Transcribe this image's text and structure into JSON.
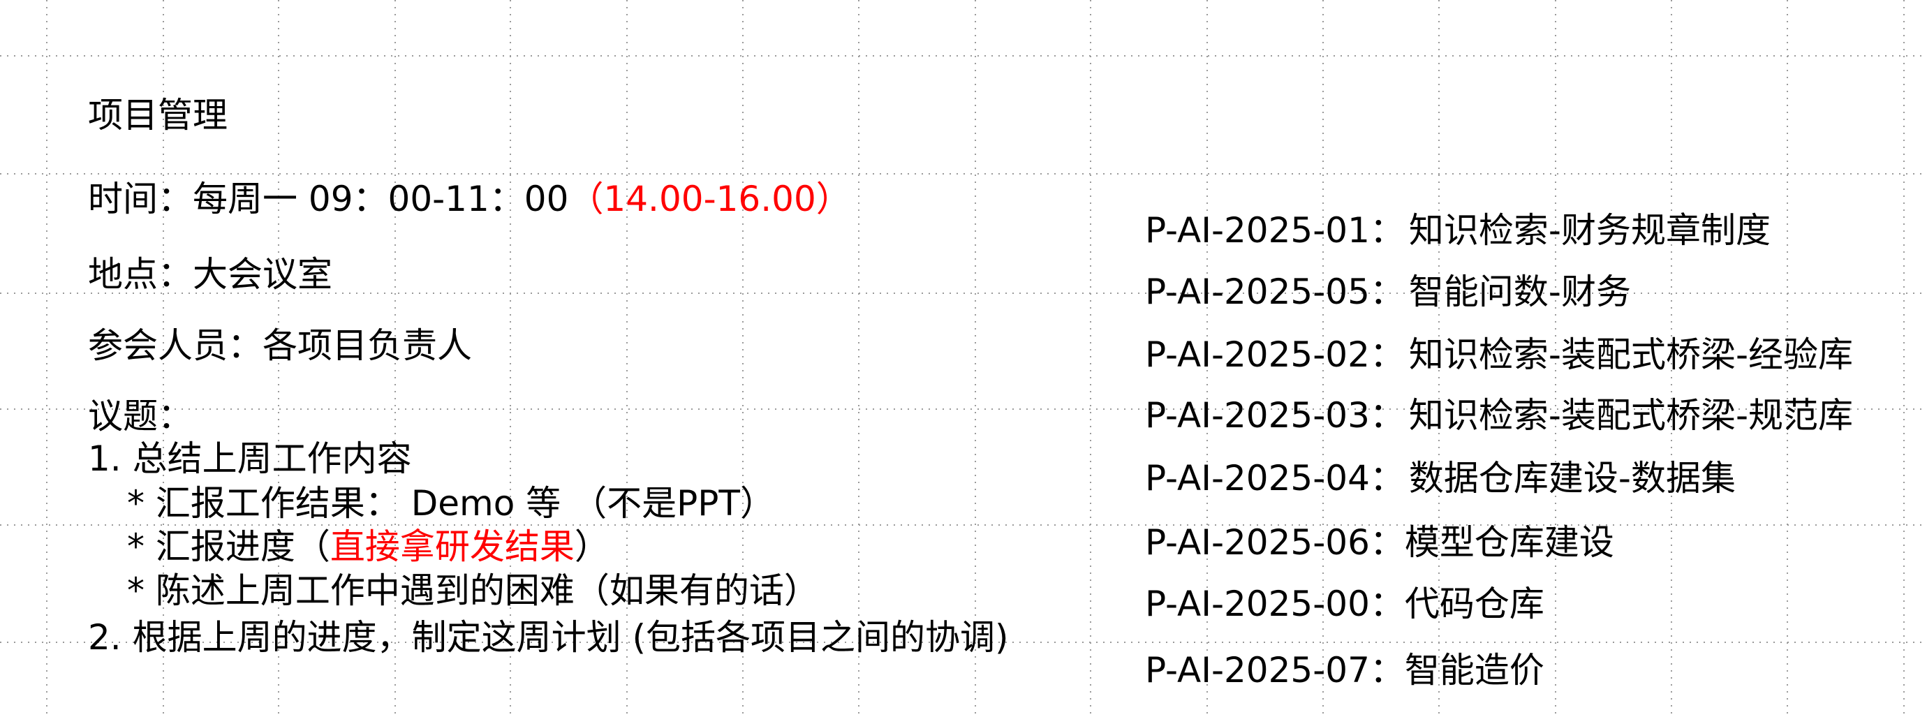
{
  "meeting": {
    "title": "项目管理",
    "time_label": "时间：",
    "time_value": "每周一 09：00-11：00",
    "time_note": "（14.00-16.00）",
    "location_label": "地点：",
    "location_value": "大会议室",
    "attendees_label": "参会人员：",
    "attendees_value": "各项目负责人",
    "agenda_label": "议题：",
    "agenda_1": "1. 总结上周工作内容",
    "agenda_1a": "* 汇报工作结果： Demo 等 （不是PPT）",
    "agenda_1b_prefix": "* 汇报进度（",
    "agenda_1b_highlight": "直接拿研发结果",
    "agenda_1b_suffix": "）",
    "agenda_1c": "* 陈述上周工作中遇到的困难（如果有的话）",
    "agenda_2": "2. 根据上周的进度，制定这周计划 (包括各项目之间的协调)"
  },
  "projects": [
    {
      "code": "P-AI-2025-01：",
      "name": "知识检索-财务规章制度"
    },
    {
      "code": "P-AI-2025-05：",
      "name": "智能问数-财务"
    },
    {
      "code": "P-AI-2025-02：",
      "name": "知识检索-装配式桥梁-经验库"
    },
    {
      "code": "P-AI-2025-03：",
      "name": "知识检索-装配式桥梁-规范库"
    },
    {
      "code": "P-AI-2025-04：",
      "name": "数据仓库建设-数据集"
    },
    {
      "code": "P-AI-2025-06：",
      "name": "模型仓库建设"
    },
    {
      "code": "P-AI-2025-00：",
      "name": "代码仓库"
    },
    {
      "code": "P-AI-2025-07：",
      "name": "智能造价"
    }
  ],
  "colors": {
    "text": "#000000",
    "highlight": "#ff0000",
    "grid": "#9a9a9a",
    "background": "#ffffff"
  }
}
